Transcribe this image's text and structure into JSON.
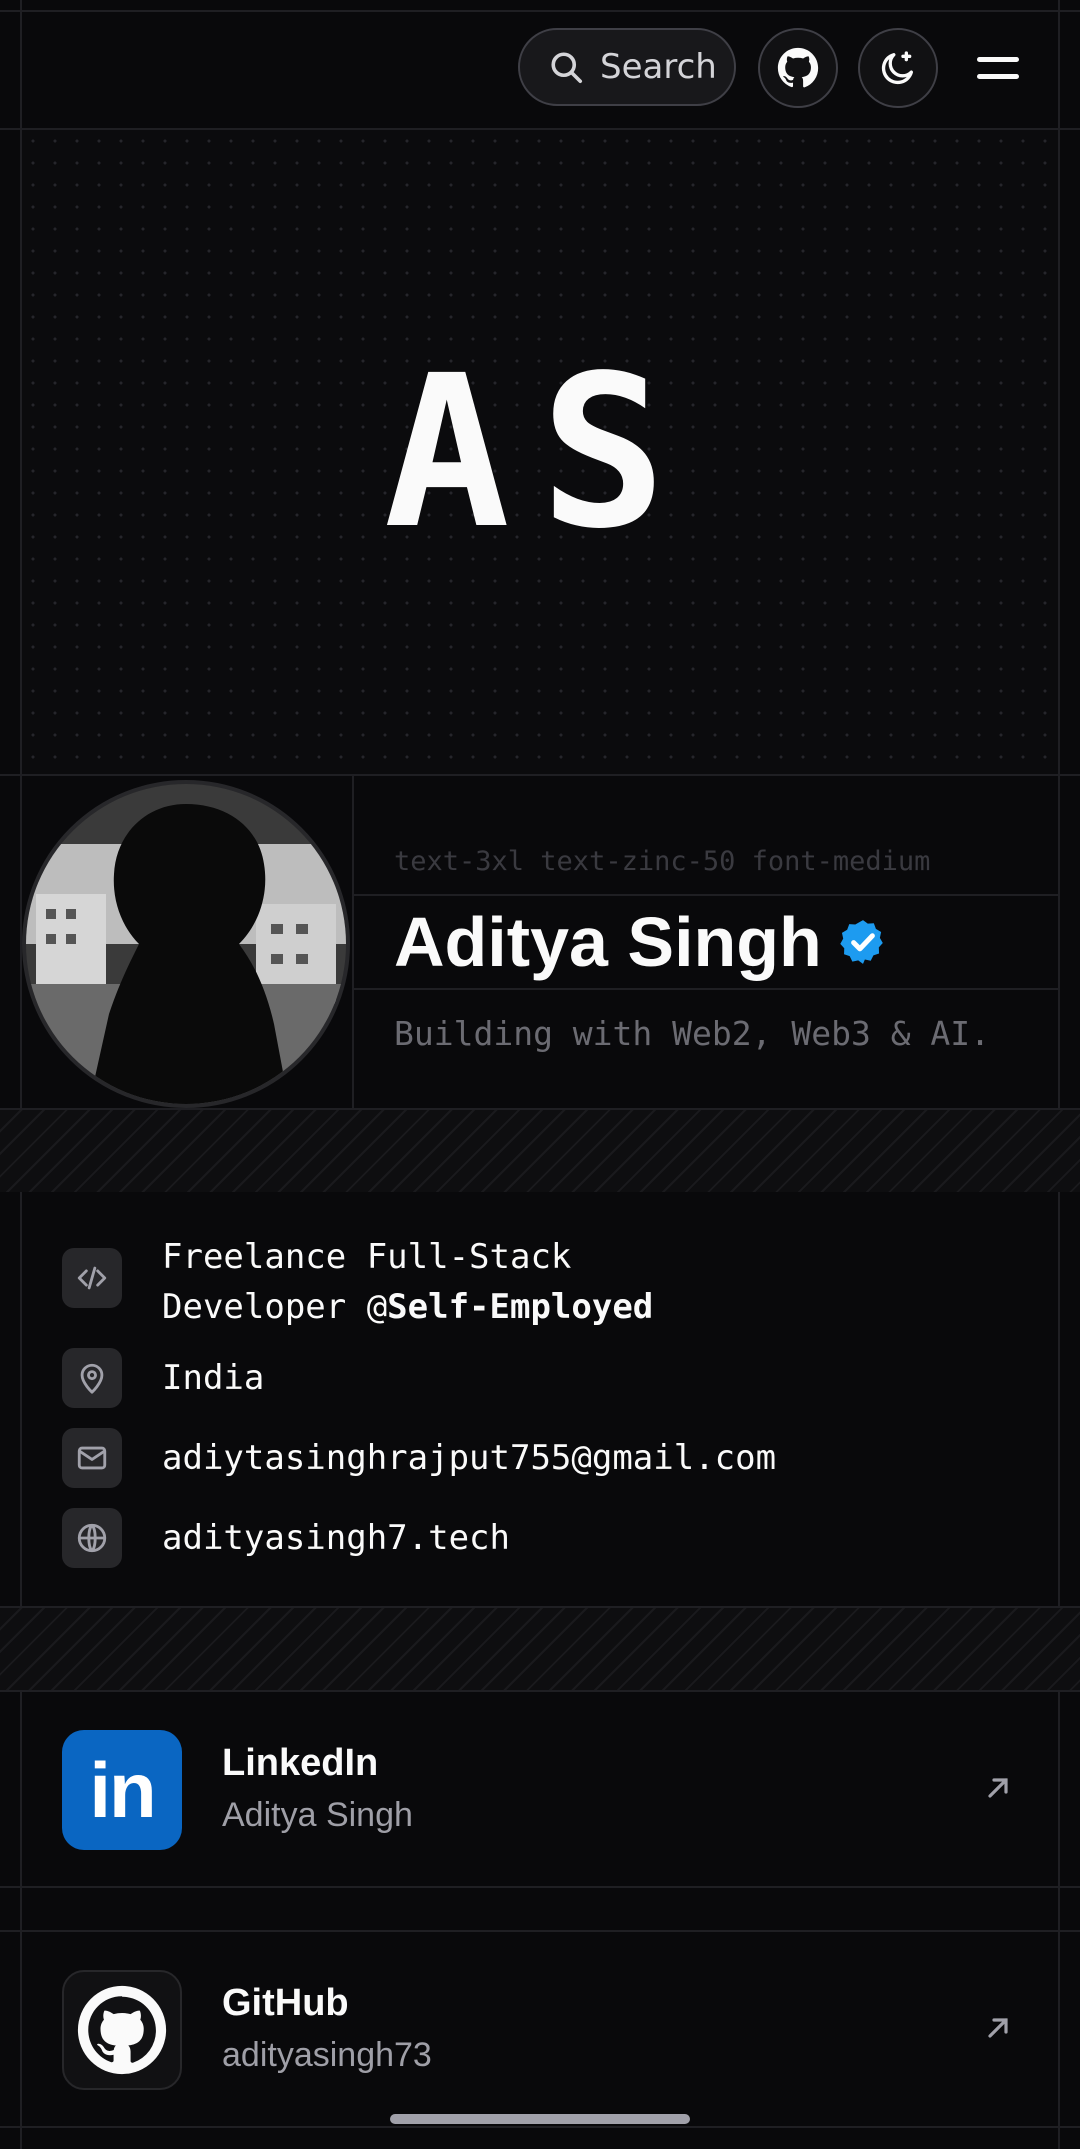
{
  "header": {
    "search_label": "Search",
    "icons": [
      "search-icon",
      "github-icon",
      "theme-toggle-icon",
      "menu-icon"
    ]
  },
  "banner": {
    "logo_text": "AS"
  },
  "profile": {
    "class_hint": "text-3xl text-zinc-50 font-medium",
    "name": "Aditya Singh",
    "tagline": "Building with Web2, Web3 & AI.",
    "verified_color": "#1d9bf0"
  },
  "info": {
    "role_line1": "Freelance Full-Stack",
    "role_line2_prefix": "Developer @",
    "company": "Self-Employed",
    "location": "India",
    "email": "adiytasinghrajput755@gmail.com",
    "website": "adityasingh7.tech"
  },
  "socials": [
    {
      "name": "LinkedIn",
      "handle": "Aditya Singh",
      "color": "#0a66c2"
    },
    {
      "name": "GitHub",
      "handle": "adityasingh73",
      "color": "#111113"
    }
  ]
}
